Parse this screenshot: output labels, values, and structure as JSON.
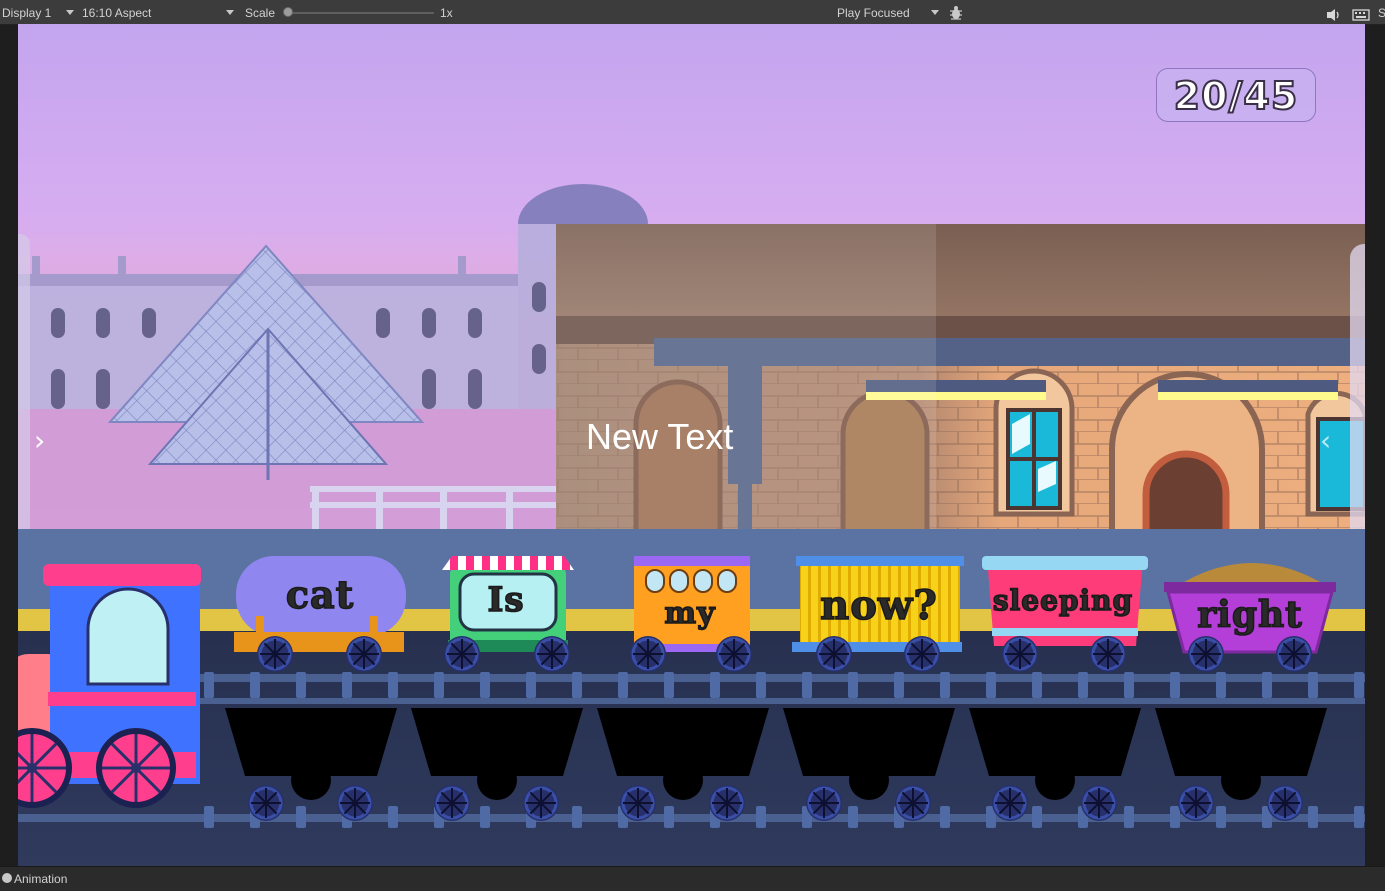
{
  "toolbar": {
    "display": "Display 1",
    "aspect": "16:10 Aspect",
    "scale_label": "Scale",
    "scale_value": "1x",
    "play_mode": "Play Focused",
    "bug_icon": "bug-icon",
    "audio_icon": "speaker-icon",
    "stats_icon": "keyboard-icon",
    "cut_off_label": "S"
  },
  "game": {
    "counter": "20/45",
    "center_text": "New Text",
    "left_arrow": "›",
    "right_arrow": "‹",
    "cars": [
      {
        "word": "cat",
        "color": "#8f86f0"
      },
      {
        "word": "Is",
        "color": "#44d07b"
      },
      {
        "word": "my",
        "color": "#ffa020"
      },
      {
        "word": "now?",
        "color": "#f7d21a"
      },
      {
        "word": "sleeping",
        "color": "#ff3c7a"
      },
      {
        "word": "right",
        "color": "#b33ed8"
      }
    ]
  },
  "bottom": {
    "tab": "Animation"
  }
}
